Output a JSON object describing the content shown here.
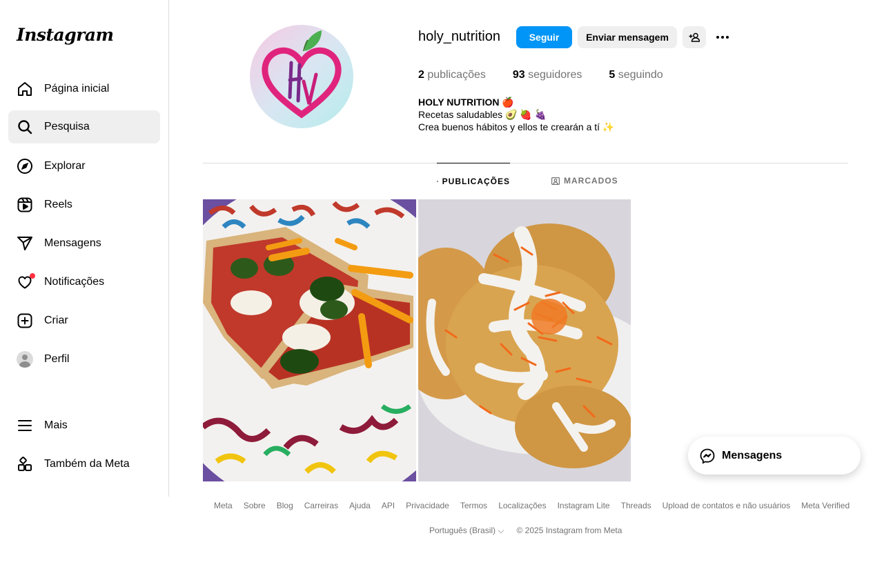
{
  "app": {
    "logo": "Instagram"
  },
  "sidebar": {
    "items": [
      {
        "label": "Página inicial",
        "icon": "home-icon"
      },
      {
        "label": "Pesquisa",
        "icon": "search-icon",
        "active": true
      },
      {
        "label": "Explorar",
        "icon": "compass-icon"
      },
      {
        "label": "Reels",
        "icon": "reels-icon"
      },
      {
        "label": "Mensagens",
        "icon": "send-icon"
      },
      {
        "label": "Notificações",
        "icon": "heart-icon"
      },
      {
        "label": "Criar",
        "icon": "plus-square-icon"
      },
      {
        "label": "Perfil",
        "icon": "avatar"
      },
      {
        "label": "Mais",
        "icon": "menu-icon"
      },
      {
        "label": "Também da Meta",
        "icon": "meta-apps-icon"
      }
    ]
  },
  "profile": {
    "username": "holy_nutrition",
    "follow_label": "Seguir",
    "message_label": "Enviar mensagem",
    "stats": {
      "posts_count": "2",
      "posts_label": "publicações",
      "followers_count": "93",
      "followers_label": "seguidores",
      "following_count": "5",
      "following_label": "seguindo"
    },
    "bio": {
      "name": "HOLY NUTRITION 🍎",
      "line1": "Recetas saludables 🥑 🍓 🍇",
      "line2": "Crea buenos hábitos y ellos te crearán a tí ✨"
    }
  },
  "tabs": [
    {
      "label": "PUBLICAÇÕES",
      "active": true
    },
    {
      "label": "MARCADOS",
      "active": false
    }
  ],
  "posts": [
    {
      "subject": "pizza-photo"
    },
    {
      "subject": "pancakes-photo"
    }
  ],
  "footer": {
    "links": [
      "Meta",
      "Sobre",
      "Blog",
      "Carreiras",
      "Ajuda",
      "API",
      "Privacidade",
      "Termos",
      "Localizações",
      "Instagram Lite",
      "Threads",
      "Upload de contatos e não usuários",
      "Meta Verified"
    ],
    "language": "Português (Brasil)",
    "copyright": "© 2025 Instagram from Meta"
  },
  "messages_pill": {
    "label": "Mensagens"
  },
  "colors": {
    "accent": "#0095f6",
    "notification": "#ff3040"
  }
}
